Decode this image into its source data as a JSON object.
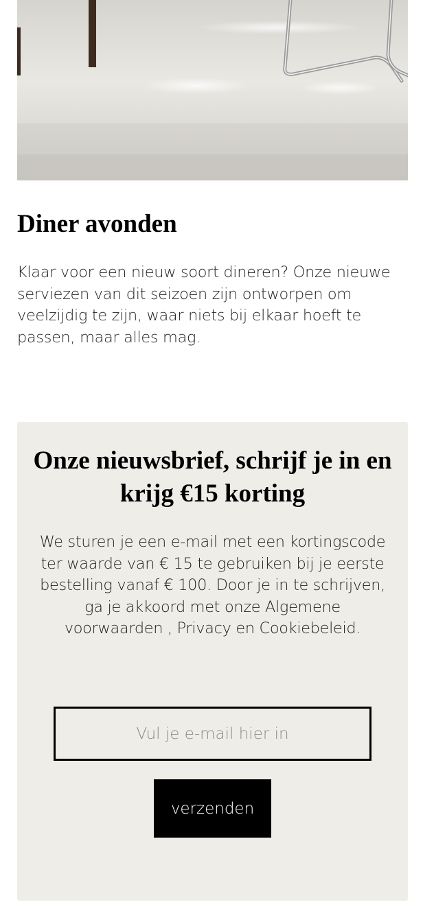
{
  "article": {
    "title": "Diner avonden",
    "body": "Klaar voor een nieuw soort dineren? Onze nieuwe serviezen van dit seizoen zijn ontworpen om veelzijdig te zijn, waar niets bij elkaar hoeft te passen, maar alles mag."
  },
  "newsletter": {
    "title": "Onze nieuwsbrief, schrijf je in en krijg €15 korting",
    "description": "We sturen je een e-mail met een kortingscode ter waarde van € 15 te gebruiken bij je eerste bestelling vanaf € 100. Door je in te schrijven, ga je akkoord met onze Algemene voorwaarden , Privacy en Cookiebeleid.",
    "email_placeholder": "Vul je e-mail hier in",
    "email_value": "",
    "submit_label": "verzenden"
  },
  "colors": {
    "newsletter_background": "#eeede7",
    "button_background": "#000000",
    "button_text": "#ffffff"
  }
}
